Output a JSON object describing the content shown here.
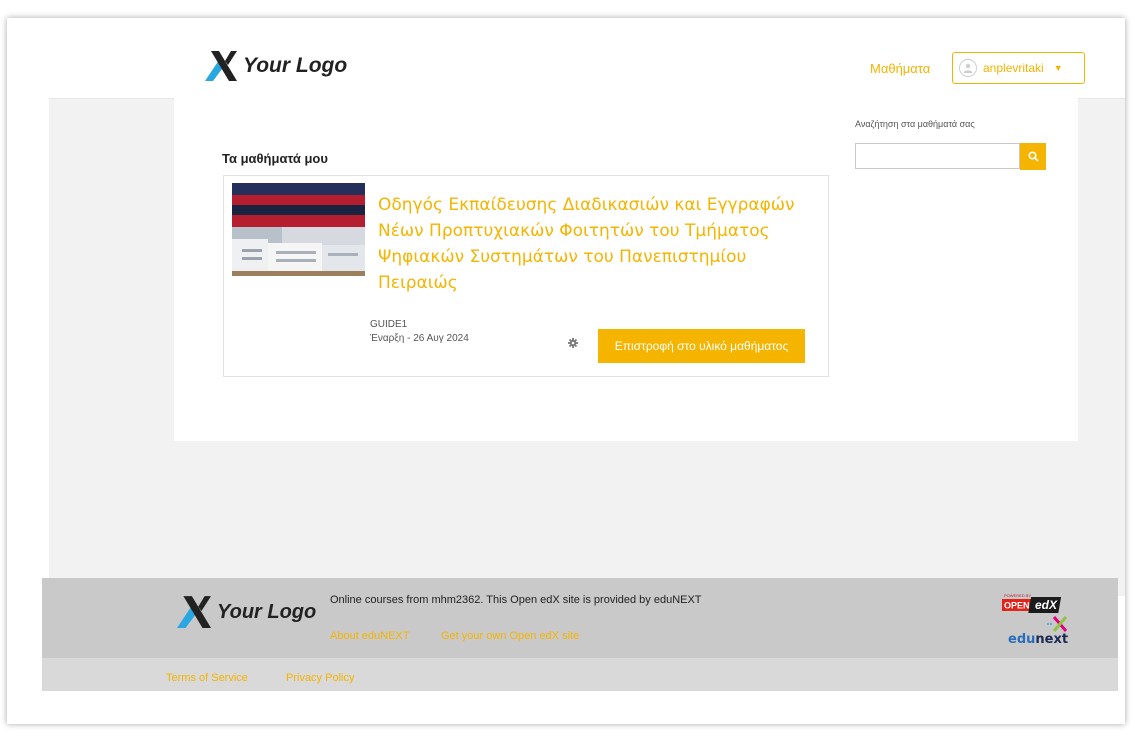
{
  "header": {
    "logo_text": "Your Logo",
    "nav_courses": "Μαθήματα",
    "username": "anplevritaki"
  },
  "main": {
    "my_courses_title": "Τα μαθήματά μου",
    "search": {
      "label": "Αναζήτηση στα μαθήματά σας",
      "value": ""
    },
    "course": {
      "title": "Οδηγός Εκπαίδευσης Διαδικασιών και Εγγραφών Νέων Προπτυχιακών Φοιτητών του Τμήματος Ψηφιακών Συστημάτων του Πανεπιστημίου Πειραιώς",
      "code": "GUIDE1",
      "start": "Έναρξη - 26 Αυγ 2024",
      "resume_label": "Επιστροφή στο υλικό μαθήματος"
    }
  },
  "footer": {
    "logo_text": "Your Logo",
    "text": "Online courses from mhm2362. This Open edX site is provided by eduNEXT",
    "link_about": "About eduNEXT",
    "link_get": "Get your own Open edX site",
    "badge_small": "POWERED BY",
    "badge_open": "OPEN",
    "badge_edx": "edX",
    "edunext_edu": "edu",
    "edunext_next": "next",
    "terms": "Terms of Service",
    "privacy": "Privacy Policy"
  },
  "colors": {
    "accent": "#f5b400",
    "logo_x_blue": "#2aa7e0",
    "logo_x_dark": "#222222",
    "footer_bg": "#c9c9c9"
  }
}
